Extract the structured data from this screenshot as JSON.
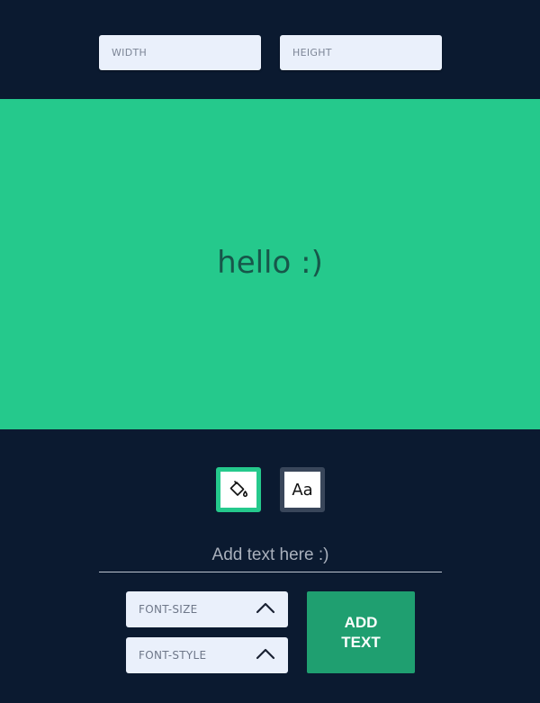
{
  "size_inputs": {
    "width_placeholder": "WIDTH",
    "height_placeholder": "HEIGHT"
  },
  "canvas": {
    "text": "hello :)",
    "background_color": "#25c98c",
    "text_color": "#17574a"
  },
  "tools": {
    "fill_icon": "paint-bucket-icon",
    "text_tool_label": "Aa"
  },
  "text_input": {
    "placeholder": "Add text here :)"
  },
  "controls": {
    "font_size_label": "FONT-SIZE",
    "font_style_label": "FONT-STYLE",
    "chevron_icon": "chevron-up-icon"
  },
  "add_button": {
    "label": "ADD\nTEXT"
  },
  "colors": {
    "page_background": "#0b1a30",
    "accent": "#25c98c",
    "button": "#1f9f70"
  }
}
